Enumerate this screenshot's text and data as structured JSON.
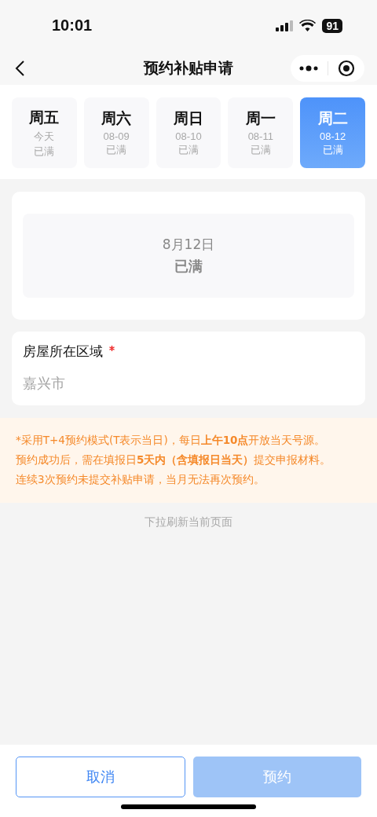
{
  "status_bar": {
    "time": "10:01",
    "battery": "91"
  },
  "nav": {
    "title": "预约补贴申请"
  },
  "days": [
    {
      "weekday": "周五",
      "date": "今天",
      "status": "已满",
      "selected": false
    },
    {
      "weekday": "周六",
      "date": "08-09",
      "status": "已满",
      "selected": false
    },
    {
      "weekday": "周日",
      "date": "08-10",
      "status": "已满",
      "selected": false
    },
    {
      "weekday": "周一",
      "date": "08-11",
      "status": "已满",
      "selected": false
    },
    {
      "weekday": "周二",
      "date": "08-12",
      "status": "已满",
      "selected": true
    }
  ],
  "slot": {
    "date": "8月12日",
    "status": "已满"
  },
  "region": {
    "label": "房屋所在区域",
    "required": true,
    "placeholder": "嘉兴市"
  },
  "notice": [
    "*采用T+4预约模式(T表示当日)，每日**上午10点**开放当天号源。",
    "预约成功后，需在填报日**5天内（含填报日当天）**提交申报材料。",
    "连续3次预约未提交补贴申请，当月无法再次预约。"
  ],
  "refresh_hint": "下拉刷新当前页面",
  "buttons": [
    {
      "kind": "outline",
      "label": "取消",
      "disabled": false
    },
    {
      "kind": "primary",
      "label": "预约",
      "disabled": true
    }
  ]
}
